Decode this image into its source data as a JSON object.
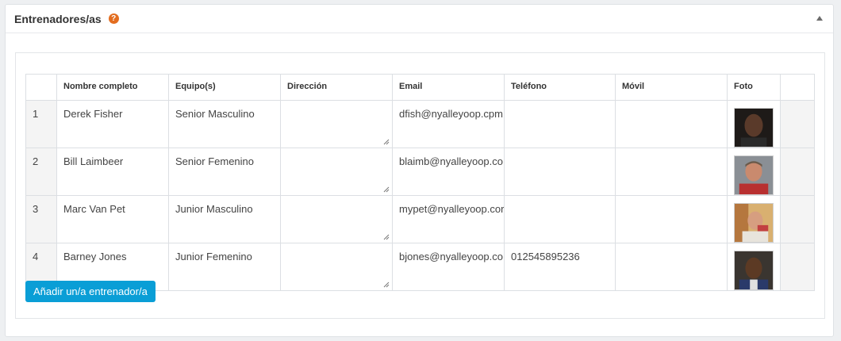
{
  "panel": {
    "title": "Entrenadores/as",
    "help_icon": "question-circle-icon",
    "collapse_icon": "caret-up-icon"
  },
  "table": {
    "headers": [
      "Nombre completo",
      "Equipo(s)",
      "Dirección",
      "Email",
      "Teléfono",
      "Móvil",
      "Foto"
    ],
    "rows": [
      {
        "num": "1",
        "name": "Derek Fisher",
        "team": "Senior Masculino",
        "address": "",
        "email": "dfish@nyalleyoop.cpm",
        "phone": "",
        "mobile": "",
        "photo": "avatar-photo"
      },
      {
        "num": "2",
        "name": "Bill Laimbeer",
        "team": "Senior Femenino",
        "address": "",
        "email": "blaimb@nyalleyoop.co",
        "phone": "",
        "mobile": "",
        "photo": "avatar-photo"
      },
      {
        "num": "3",
        "name": "Marc Van Pet",
        "team": "Junior Masculino",
        "address": "",
        "email": "mypet@nyalleyoop.cor",
        "phone": "",
        "mobile": "",
        "photo": "avatar-photo"
      },
      {
        "num": "4",
        "name": "Barney Jones",
        "team": "Junior Femenino",
        "address": "",
        "email": "bjones@nyalleyoop.co",
        "phone": "012545895236",
        "mobile": "",
        "photo": "avatar-photo"
      }
    ]
  },
  "add_button_label": "Añadir un/a entrenador/a",
  "colors": {
    "accent": "#0a9ed6",
    "help": "#e36d1f"
  }
}
